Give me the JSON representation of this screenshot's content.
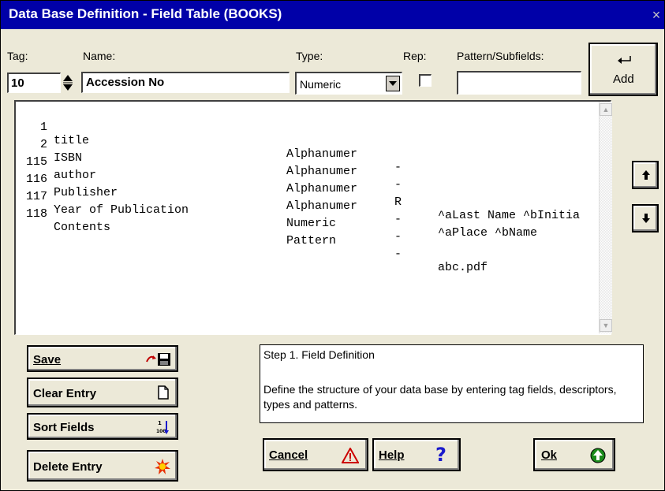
{
  "window": {
    "title": "Data Base Definition - Field Table (BOOKS)",
    "close_label": "×"
  },
  "labels": {
    "tag": "Tag:",
    "name": "Name:",
    "type": "Type:",
    "rep": "Rep:",
    "pattern": "Pattern/Subfields:"
  },
  "inputs": {
    "tag_value": "10",
    "name_value": "Accession No",
    "type_value": "Numeric",
    "pattern_value": ""
  },
  "add_button": {
    "label": "Add",
    "icon": "enter-icon"
  },
  "fields": [
    {
      "tag": "1",
      "name": "title",
      "type": "Alphanumer",
      "rep": "-",
      "pattern": ""
    },
    {
      "tag": "2",
      "name": "ISBN",
      "type": "Alphanumer",
      "rep": "-",
      "pattern": ""
    },
    {
      "tag": "115",
      "name": "author",
      "type": "Alphanumer",
      "rep": "R",
      "pattern": "^aLast Name ^bInitia"
    },
    {
      "tag": "116",
      "name": "Publisher",
      "type": "Alphanumer",
      "rep": "-",
      "pattern": "^aPlace ^bName"
    },
    {
      "tag": "117",
      "name": "Year of Publication",
      "type": "Numeric",
      "rep": "-",
      "pattern": ""
    },
    {
      "tag": "118",
      "name": "Contents",
      "type": "Pattern",
      "rep": "-",
      "pattern": "abc.pdf"
    }
  ],
  "side_buttons": {
    "save": {
      "label": "Save",
      "icon": "save-disk-icon"
    },
    "clear": {
      "label": "Clear Entry",
      "icon": "new-document-icon"
    },
    "sort": {
      "label": "Sort Fields",
      "icon": "sort-icon"
    },
    "delete": {
      "label": "Delete Entry",
      "icon": "explosion-icon"
    }
  },
  "help_text": {
    "heading": "Step 1. Field Definition",
    "body": "Define the structure of your data base by entering tag fields, descriptors, types and patterns."
  },
  "bottom_buttons": {
    "cancel": {
      "label": "Cancel",
      "icon": "warning-icon"
    },
    "help": {
      "label": "Help",
      "icon": "question-icon"
    },
    "ok": {
      "label": "Ok",
      "icon": "green-up-arrow-icon"
    }
  },
  "colors": {
    "titlebar": "#0000a8",
    "dialog": "#ece9d8",
    "ok_icon": "#1a8a1a",
    "warning": "#cc0000",
    "help_icon": "#1a1acc"
  }
}
